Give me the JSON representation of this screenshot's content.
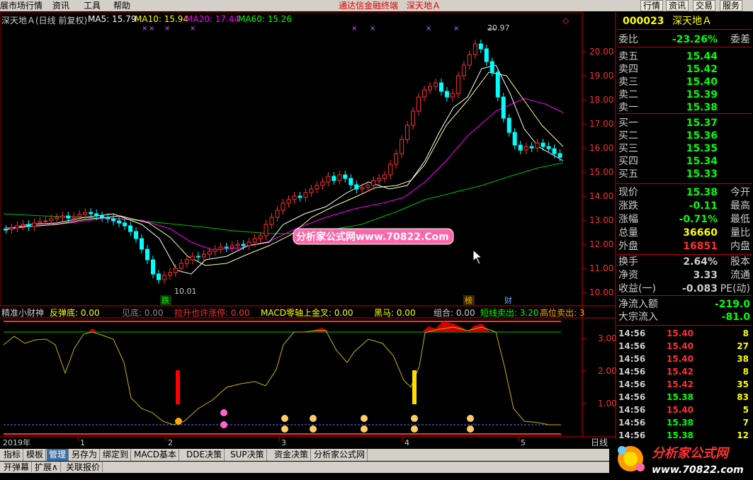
{
  "menubar": {
    "items": [
      "展市场行情",
      "资讯",
      "工具",
      "帮助"
    ],
    "center": [
      "通达信金融终端",
      "深天地Ａ"
    ],
    "right_buttons": [
      "行情",
      "资讯",
      "交易",
      "服务"
    ]
  },
  "main_title": {
    "stock": "深天地Ａ(日线 前复权)",
    "ma5": "MA5: 15.79",
    "ma10": "MA10: 15.94",
    "ma20": "MA20: 17.44",
    "ma60": "MA60: 15.26"
  },
  "colors": {
    "ma5": "#ffffff",
    "ma10": "#ffff00",
    "ma20": "#ff00ff",
    "ma60": "#00c000",
    "up": "#ff3030",
    "down": "#00ffff",
    "axis": "#cc0000"
  },
  "price_axis": [
    "20.00",
    "19.00",
    "18.00",
    "17.00",
    "16.00",
    "15.00",
    "14.00",
    "13.00",
    "12.00",
    "11.00",
    "10.00"
  ],
  "markers": {
    "high": "20.97",
    "low": "10.01",
    "tag_die": "跌",
    "tag_bang": "榜",
    "tag_cai": "财"
  },
  "watermark_center": "分析家公式网www.70822.Com",
  "indicator_title": {
    "name": "精准小财神",
    "fantan": "反弹底: 0.00",
    "jiandi": "见底: 0.00",
    "lasheng": "拉升也许涨停: 0.00",
    "macd": "MACD零轴上金叉: 0.00",
    "heima": "黑马: 0.00",
    "zuhe": "组合: 0.00",
    "duanxian": "短线卖出: 3.20",
    "gaowei": "高位卖出: 3"
  },
  "ind_axis": [
    "3.00",
    "2.00",
    "1.00"
  ],
  "date_axis": {
    "year": "2019年",
    "m1": "1",
    "m2": "2",
    "m3": "3",
    "m4": "4",
    "m5": "5",
    "period": "日线"
  },
  "panel": {
    "code": "000023",
    "name": "深天地Ａ",
    "weibi_label": "委比",
    "weibi": "-23.26%",
    "weicha": "委差",
    "asks": [
      {
        "label": "卖五",
        "price": "15.44"
      },
      {
        "label": "卖四",
        "price": "15.42"
      },
      {
        "label": "卖三",
        "price": "15.40"
      },
      {
        "label": "卖二",
        "price": "15.39"
      },
      {
        "label": "卖一",
        "price": "15.38"
      }
    ],
    "bids": [
      {
        "label": "买一",
        "price": "15.37"
      },
      {
        "label": "买二",
        "price": "15.36"
      },
      {
        "label": "买三",
        "price": "15.35"
      },
      {
        "label": "买四",
        "price": "15.34"
      },
      {
        "label": "买五",
        "price": "15.33"
      }
    ],
    "stats": [
      {
        "label": "现价",
        "value": "15.38",
        "right": "今开",
        "color": "#00ff00"
      },
      {
        "label": "涨跌",
        "value": "-0.11",
        "right": "最高",
        "color": "#00ff00"
      },
      {
        "label": "涨幅",
        "value": "-0.71%",
        "right": "最低",
        "color": "#00ff00"
      },
      {
        "label": "总量",
        "value": "36660",
        "right": "量比",
        "color": "#ffff00"
      },
      {
        "label": "外盘",
        "value": "16851",
        "right": "内盘",
        "color": "#ff3030"
      }
    ],
    "stats2": [
      {
        "label": "换手",
        "value": "2.64%",
        "right": "股本",
        "color": "#cccccc"
      },
      {
        "label": "净资",
        "value": "3.33",
        "right": "流通",
        "color": "#cccccc"
      },
      {
        "label": "收益(一)",
        "value": "-0.083",
        "right": "PE(动)",
        "color": "#cccccc"
      }
    ],
    "flows": [
      {
        "label": "净流入额",
        "value": "-219.0"
      },
      {
        "label": "大宗流入",
        "value": "-81.0"
      }
    ],
    "ticks": [
      {
        "time": "14:56",
        "price": "15.40",
        "vol": "8",
        "color": "#ff3030"
      },
      {
        "time": "14:56",
        "price": "15.40",
        "vol": "27",
        "color": "#ff3030"
      },
      {
        "time": "14:56",
        "price": "15.40",
        "vol": "38",
        "color": "#ff3030"
      },
      {
        "time": "14:56",
        "price": "15.42",
        "vol": "8",
        "color": "#ff3030"
      },
      {
        "time": "14:56",
        "price": "15.42",
        "vol": "35",
        "color": "#ff3030"
      },
      {
        "time": "14:56",
        "price": "15.38",
        "vol": "83",
        "color": "#00ff00"
      },
      {
        "time": "14:56",
        "price": "15.40",
        "vol": "5",
        "color": "#ff3030"
      },
      {
        "time": "14:56",
        "price": "15.38",
        "vol": "7",
        "color": "#00ff00"
      },
      {
        "time": "14:56",
        "price": "15.38",
        "vol": "12",
        "color": "#00ff00"
      }
    ]
  },
  "tabs": [
    "指标",
    "模板",
    "管理",
    "另存为",
    "绑定到",
    "MACD基本",
    "DDE决策",
    "SUP决策",
    "资金决策",
    "分析家公式网"
  ],
  "tabs2": [
    "开弹幕",
    "扩展∧",
    "关联报价"
  ],
  "brand": {
    "name": "分析家公式网",
    "url": "www.70822.com"
  }
}
